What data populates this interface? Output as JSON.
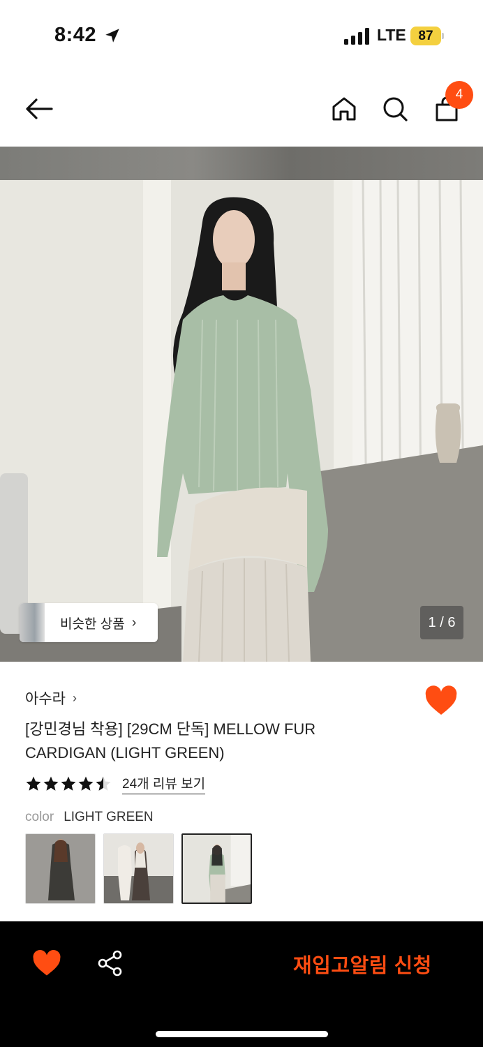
{
  "status_bar": {
    "time": "8:42",
    "network": "LTE",
    "battery": "87"
  },
  "nav": {
    "cart_count": "4",
    "icons": [
      "back-arrow-icon",
      "home-icon",
      "search-icon",
      "shopping-bag-icon"
    ]
  },
  "gallery": {
    "similar_label": "비슷한 상품",
    "similar_chevron": "›",
    "page_indicator": "1 / 6"
  },
  "product": {
    "brand": "아수라",
    "brand_chevron": "›",
    "title": "[강민경님 착용] [29CM 단독] MELLOW FUR CARDIGAN (LIGHT GREEN)",
    "rating": 4.5,
    "review_link": "24개 리뷰 보기",
    "color_label": "color",
    "color_value": "LIGHT GREEN",
    "liked": true
  },
  "bottom_bar": {
    "restock_label": "재입고알림 신청"
  },
  "colors": {
    "accent": "#ff4d12",
    "star": "#111111",
    "badge": "#ff4d12"
  }
}
